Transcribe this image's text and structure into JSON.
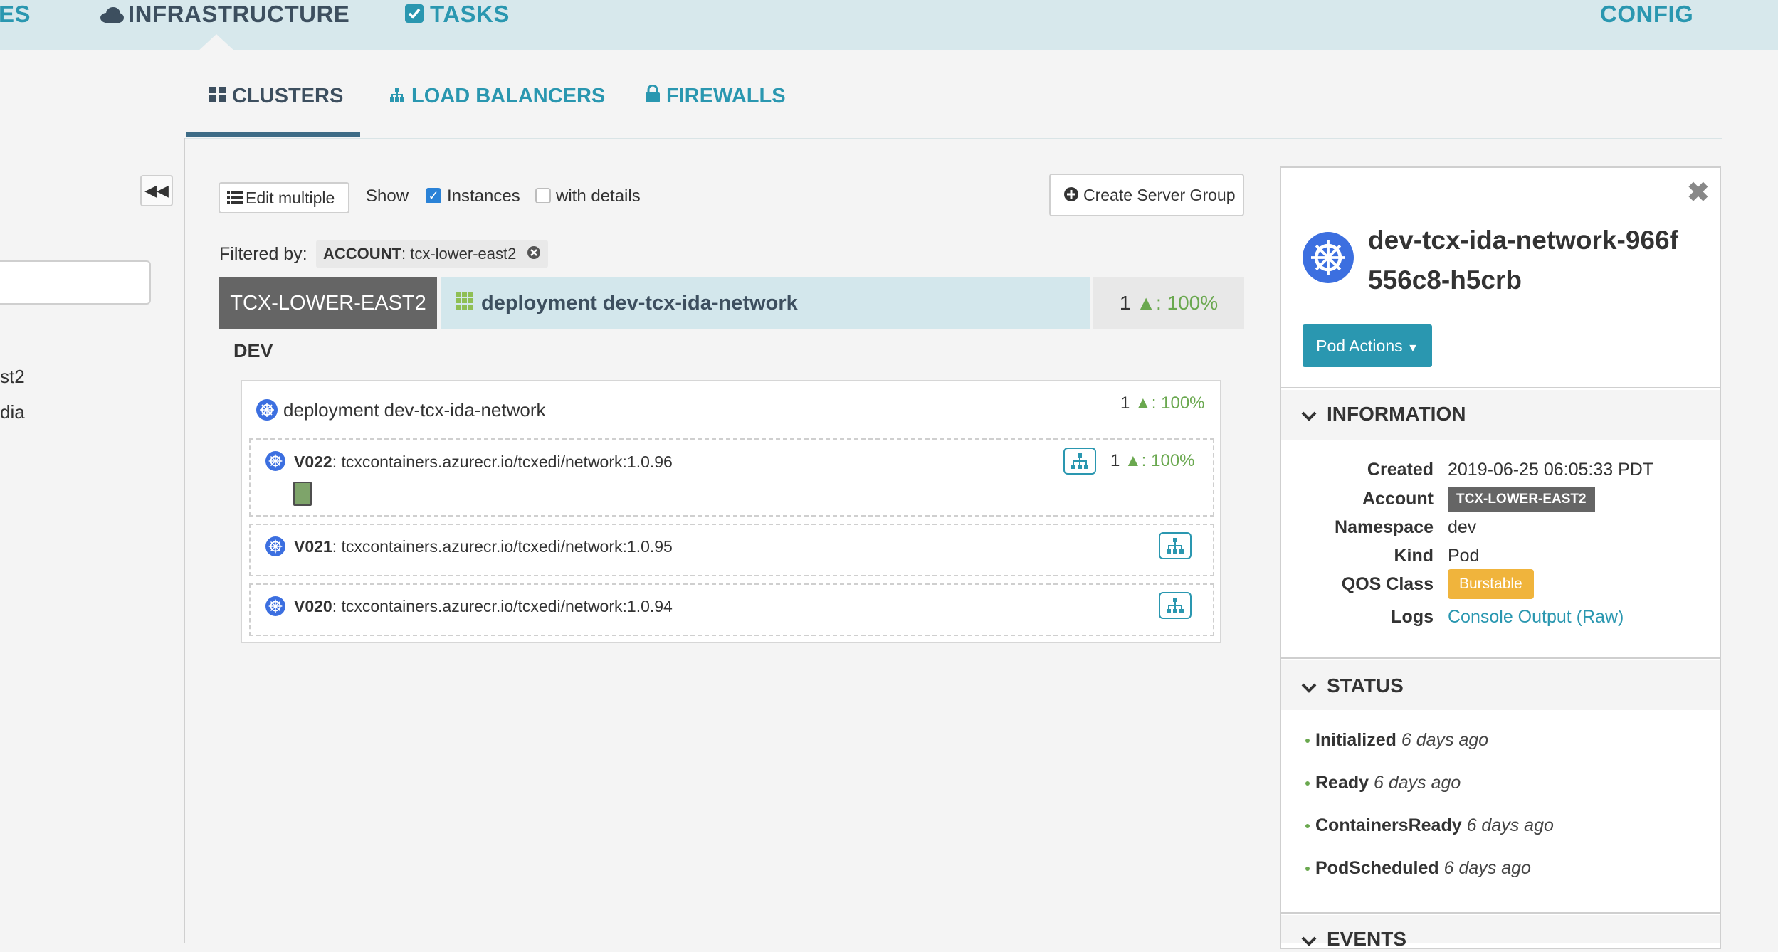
{
  "topnav": {
    "partial_left": "ES",
    "infrastructure": "INFRASTRUCTURE",
    "tasks": "TASKS",
    "config": "CONFIG"
  },
  "subnav": {
    "clusters": "CLUSTERS",
    "load_balancers": "LOAD BALANCERS",
    "firewalls": "FIREWALLS"
  },
  "sidebar": {
    "collapse_icon": "double-chevron-left-icon",
    "items": [
      "st2",
      "dia"
    ]
  },
  "toolbar": {
    "edit_multiple": "Edit multiple",
    "show": "Show",
    "instances": "Instances",
    "with_details": "with details",
    "create_server_group": "Create Server Group"
  },
  "filter": {
    "label": "Filtered by:",
    "tag_key": "ACCOUNT",
    "tag_value": ": tcx-lower-east2"
  },
  "cluster": {
    "account": "TCX-LOWER-EAST2",
    "deployment": "deployment dev-tcx-ida-network",
    "health_count": "1",
    "health_pct": ": 100%",
    "env": "DEV",
    "box_title": "deployment dev-tcx-ida-network",
    "box_count": "1",
    "box_pct": ": 100%",
    "server_groups": [
      {
        "version": "V022",
        "image": ": tcxcontainers.azurecr.io/tcxedi/network:1.0.96",
        "count": "1",
        "pct": ": 100%"
      },
      {
        "version": "V021",
        "image": ": tcxcontainers.azurecr.io/tcxedi/network:1.0.95"
      },
      {
        "version": "V020",
        "image": ": tcxcontainers.azurecr.io/tcxedi/network:1.0.94"
      }
    ]
  },
  "detail": {
    "title_line1": "dev-tcx-ida-network-966f",
    "title_line2": "556c8-h5crb",
    "actions_button": "Pod Actions",
    "information_title": "INFORMATION",
    "fields": {
      "created_key": "Created",
      "created_val": "2019-06-25 06:05:33 PDT",
      "account_key": "Account",
      "account_val": "TCX-LOWER-EAST2",
      "namespace_key": "Namespace",
      "namespace_val": "dev",
      "kind_key": "Kind",
      "kind_val": "Pod",
      "qos_key": "QOS Class",
      "qos_val": "Burstable",
      "logs_key": "Logs",
      "logs_val": "Console Output (Raw)"
    },
    "status_title": "STATUS",
    "statuses": [
      {
        "name": "Initialized",
        "when": "6 days ago"
      },
      {
        "name": "Ready",
        "when": "6 days ago"
      },
      {
        "name": "ContainersReady",
        "when": "6 days ago"
      },
      {
        "name": "PodScheduled",
        "when": "6 days ago"
      }
    ],
    "events_title": "EVENTS"
  },
  "colors": {
    "accent": "#2a97b0",
    "nav_dark": "#3d4f5f",
    "healthy": "#6aa84f",
    "burstable": "#f0b43c",
    "k8s_blue": "#3c6fe0"
  }
}
